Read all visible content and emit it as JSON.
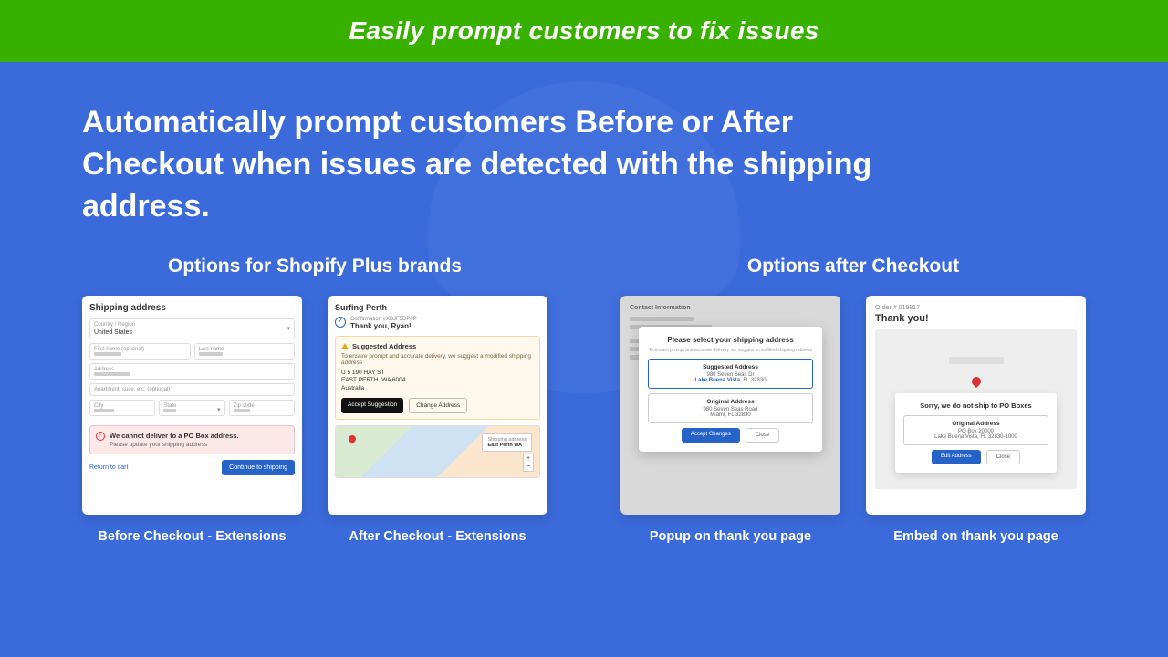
{
  "banner": "Easily prompt customers to fix issues",
  "headline": "Automatically prompt customers Before or After Checkout when issues are detected with the shipping address.",
  "group_a_title": "Options for Shopify Plus brands",
  "group_b_title": "Options after Checkout",
  "card1": {
    "heading": "Shipping address",
    "country_label": "Country / Region",
    "country_value": "United States",
    "first_label": "First name (optional)",
    "last_label": "Last name",
    "address_label": "Address",
    "apt_label": "Apartment, suite, etc. (optional)",
    "city_label": "City",
    "state_label": "State",
    "zip_label": "Zip code",
    "error_title": "We cannot deliver to a PO Box address.",
    "error_sub": "Please update your shipping address",
    "return_link": "Return to cart",
    "continue_btn": "Continue to shipping",
    "caption": "Before Checkout - Extensions"
  },
  "card2": {
    "brand": "Surfing Perth",
    "conf_num": "Confirmation #XBJF5DP0P",
    "thanks": "Thank you, Ryan!",
    "sug_title": "Suggested Address",
    "sug_desc": "To ensure prompt and accurate delivery, we suggest a modified shipping address",
    "addr_l1": "U 5 190 HAY ST",
    "addr_l2": "EAST PERTH, WA 6004",
    "addr_l3": "Australia",
    "accept_btn": "Accept Suggestion",
    "change_btn": "Change Address",
    "map_label": "Shipping address",
    "map_value": "East Perth WA",
    "caption": "After Checkout - Extensions"
  },
  "card3": {
    "bg_title": "Contact Information",
    "modal_title": "Please select your shipping address",
    "modal_sub": "To ensure prompt and accurate delivery, we suggest a modified shipping address",
    "suggested_title": "Suggested Address",
    "suggested_l1": "980 Seven Seas Dr",
    "suggested_l2_a": "Lake Buena Vista",
    "suggested_l2_b": ", FL 32830",
    "original_title": "Original Address",
    "original_l1": "980 Seven Seas Road",
    "original_l2": "Miami, FL 32830",
    "accept_btn": "Accept Changes",
    "close_btn": "Close",
    "caption": "Popup on thank you page"
  },
  "card4": {
    "order_num": "Order # 019817",
    "thank": "Thank you!",
    "modal_title": "Sorry, we do not ship to PO Boxes",
    "box_title": "Original Address",
    "box_l1": "PO Box 20000",
    "box_l2": "Lake Buena Vista, FL 32830-1000",
    "edit_btn": "Edit Address",
    "close_btn": "Close",
    "caption": "Embed on thank you page"
  }
}
